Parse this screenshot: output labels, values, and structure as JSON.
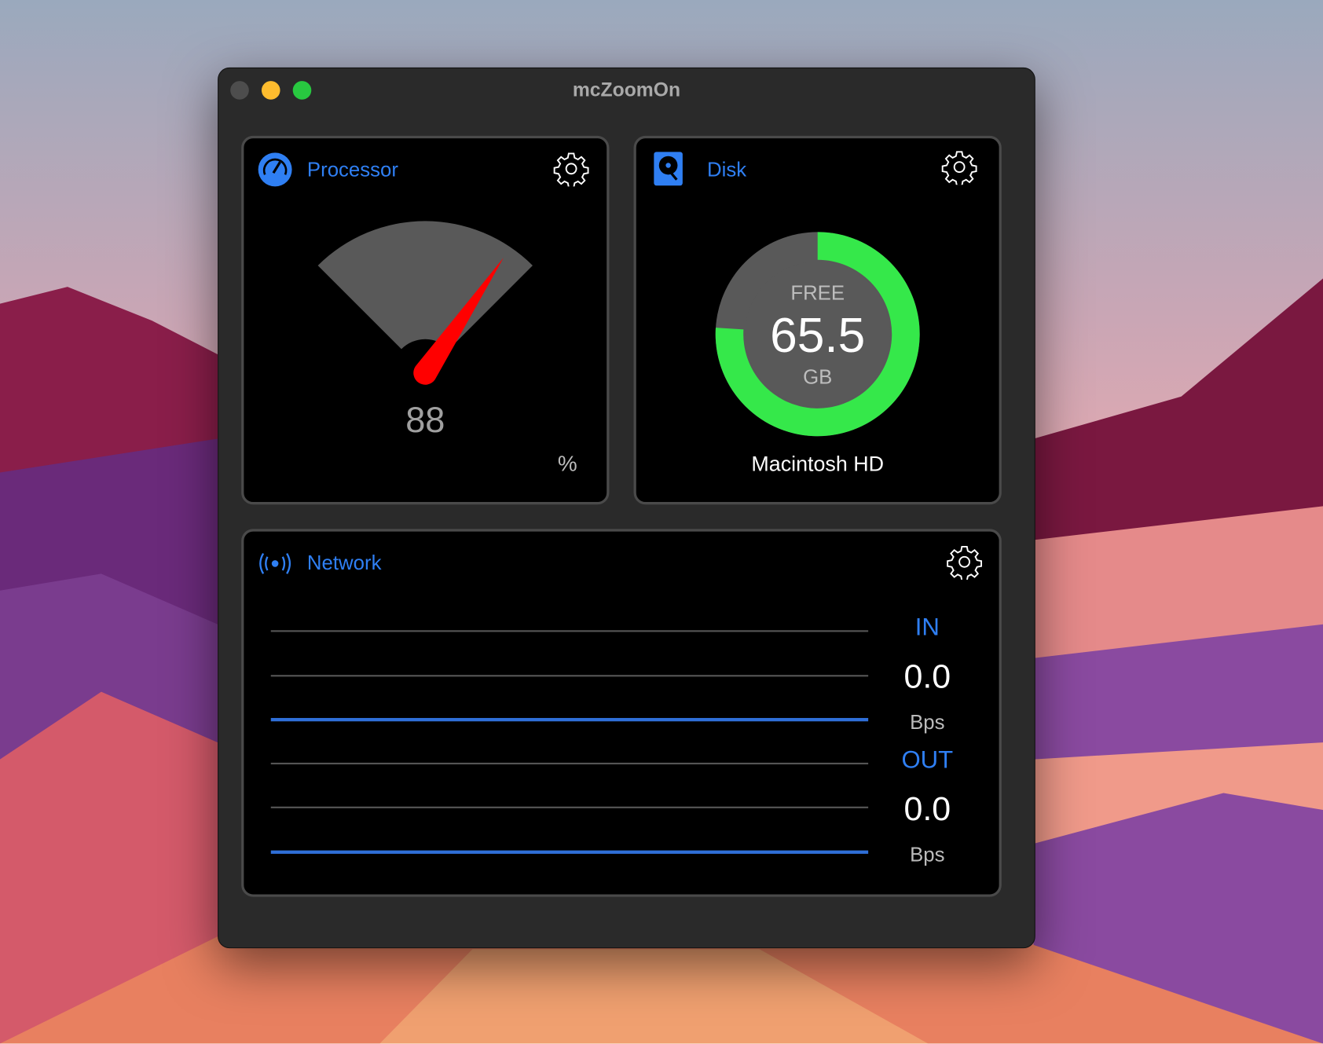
{
  "window": {
    "title": "mcZoomOn"
  },
  "colors": {
    "accent": "#2f7ff3",
    "needle": "#ff0000",
    "disk_free": "#35e84a",
    "gauge": "#595959",
    "traffic_close": "#4d4d4d",
    "traffic_min": "#febc2e",
    "traffic_max": "#28c840"
  },
  "processor": {
    "title": "Processor",
    "icon": "speedometer-icon",
    "value": "88",
    "usage_percent": 88,
    "unit": "%"
  },
  "disk": {
    "title": "Disk",
    "icon": "hard-drive-icon",
    "free_label": "FREE",
    "free_value": "65.5",
    "free_unit": "GB",
    "free_fraction": 0.76,
    "volume": "Macintosh HD"
  },
  "network": {
    "title": "Network",
    "icon": "antenna-icon",
    "in": {
      "label": "IN",
      "value": "0.0",
      "unit": "Bps"
    },
    "out": {
      "label": "OUT",
      "value": "0.0",
      "unit": "Bps"
    }
  }
}
